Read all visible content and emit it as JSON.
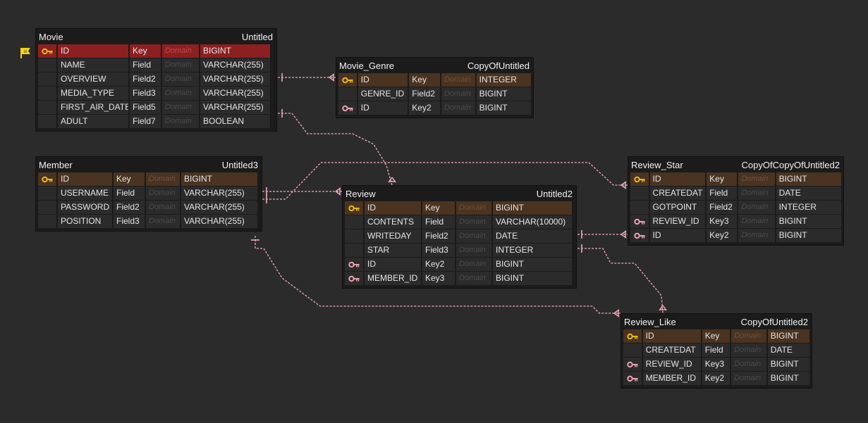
{
  "tables": {
    "movie": {
      "name": "Movie",
      "alias": "Untitled",
      "rows": [
        {
          "name": "ID",
          "type": "Key",
          "domain": "Domain",
          "datatype": "BIGINT",
          "icon": "primary-key-icon"
        },
        {
          "name": "NAME",
          "type": "Field",
          "domain": "Domain",
          "datatype": "VARCHAR(255)",
          "icon": ""
        },
        {
          "name": "OVERVIEW",
          "type": "Field2",
          "domain": "Domain",
          "datatype": "VARCHAR(255)",
          "icon": ""
        },
        {
          "name": "MEDIA_TYPE",
          "type": "Field3",
          "domain": "Domain",
          "datatype": "VARCHAR(255)",
          "icon": ""
        },
        {
          "name": "FIRST_AIR_DATE",
          "type": "Field5",
          "domain": "Domain",
          "datatype": "VARCHAR(255)",
          "icon": ""
        },
        {
          "name": "ADULT",
          "type": "Field7",
          "domain": "Domain",
          "datatype": "BOOLEAN",
          "icon": ""
        }
      ]
    },
    "movie_genre": {
      "name": "Movie_Genre",
      "alias": "CopyOfUntitled",
      "rows": [
        {
          "name": "ID",
          "type": "Key",
          "domain": "Domain",
          "datatype": "INTEGER",
          "icon": "primary-key-icon"
        },
        {
          "name": "GENRE_ID",
          "type": "Field2",
          "domain": "Domain",
          "datatype": "BIGINT",
          "icon": ""
        },
        {
          "name": "ID",
          "type": "Key2",
          "domain": "Domain",
          "datatype": "BIGINT",
          "icon": "foreign-key-icon"
        }
      ]
    },
    "member": {
      "name": "Member",
      "alias": "Untitled3",
      "rows": [
        {
          "name": "ID",
          "type": "Key",
          "domain": "Domain",
          "datatype": "BIGINT",
          "icon": "primary-key-icon"
        },
        {
          "name": "USERNAME",
          "type": "Field",
          "domain": "Domain",
          "datatype": "VARCHAR(255)",
          "icon": ""
        },
        {
          "name": "PASSWORD",
          "type": "Field2",
          "domain": "Domain",
          "datatype": "VARCHAR(255)",
          "icon": ""
        },
        {
          "name": "POSITION",
          "type": "Field3",
          "domain": "Domain",
          "datatype": "VARCHAR(255)",
          "icon": ""
        }
      ]
    },
    "review": {
      "name": "Review",
      "alias": "Untitled2",
      "rows": [
        {
          "name": "ID",
          "type": "Key",
          "domain": "Domain",
          "datatype": "BIGINT",
          "icon": "primary-key-icon"
        },
        {
          "name": "CONTENTS",
          "type": "Field",
          "domain": "Domain",
          "datatype": "VARCHAR(10000)",
          "icon": ""
        },
        {
          "name": "WRITEDAY",
          "type": "Field2",
          "domain": "Domain",
          "datatype": "DATE",
          "icon": ""
        },
        {
          "name": "STAR",
          "type": "Field3",
          "domain": "Domain",
          "datatype": "INTEGER",
          "icon": ""
        },
        {
          "name": "ID",
          "type": "Key2",
          "domain": "Domain",
          "datatype": "BIGINT",
          "icon": "foreign-key-icon"
        },
        {
          "name": "MEMBER_ID",
          "type": "Key3",
          "domain": "Domain",
          "datatype": "BIGINT",
          "icon": "foreign-key-icon"
        }
      ]
    },
    "review_star": {
      "name": "Review_Star",
      "alias": "CopyOfCopyOfUntitled2",
      "rows": [
        {
          "name": "ID",
          "type": "Key",
          "domain": "Domain",
          "datatype": "BIGINT",
          "icon": "primary-key-icon"
        },
        {
          "name": "CREATEDAT",
          "type": "Field",
          "domain": "Domain",
          "datatype": "DATE",
          "icon": ""
        },
        {
          "name": "GOTPOINT",
          "type": "Field2",
          "domain": "Domain",
          "datatype": "INTEGER",
          "icon": ""
        },
        {
          "name": "REVIEW_ID",
          "type": "Key3",
          "domain": "Domain",
          "datatype": "BIGINT",
          "icon": "foreign-key-icon"
        },
        {
          "name": "ID",
          "type": "Key2",
          "domain": "Domain",
          "datatype": "BIGINT",
          "icon": "foreign-key-icon"
        }
      ]
    },
    "review_like": {
      "name": "Review_Like",
      "alias": "CopyOfUntitled2",
      "rows": [
        {
          "name": "ID",
          "type": "Key",
          "domain": "Domain",
          "datatype": "BIGINT",
          "icon": "primary-key-icon"
        },
        {
          "name": "CREATEDAT",
          "type": "Field",
          "domain": "Domain",
          "datatype": "DATE",
          "icon": ""
        },
        {
          "name": "REVIEW_ID",
          "type": "Key3",
          "domain": "Domain",
          "datatype": "BIGINT",
          "icon": "foreign-key-icon"
        },
        {
          "name": "MEMBER_ID",
          "type": "Key2",
          "domain": "Domain",
          "datatype": "BIGINT",
          "icon": "foreign-key-icon"
        }
      ]
    }
  },
  "selected_row": "movie.0",
  "colors": {
    "background": "#2b2b2b",
    "table_bg": "#1b1b1b",
    "cell_bg": "#2b2b2b",
    "pk_row": "#4a3320",
    "selected_row": "#8c2020",
    "relation_line": "#f0aab8",
    "primary_key_icon": "#e8b818",
    "foreign_key_icon": "#e8a0b0",
    "flag_icon": "#f2d21a"
  },
  "relations": [
    {
      "from": "movie_genre",
      "to": "movie"
    },
    {
      "from": "review",
      "to": "movie"
    },
    {
      "from": "review",
      "to": "member"
    },
    {
      "from": "review_star",
      "to": "member"
    },
    {
      "from": "review_star",
      "to": "review"
    },
    {
      "from": "review_like",
      "to": "review"
    },
    {
      "from": "review_like",
      "to": "member"
    }
  ]
}
